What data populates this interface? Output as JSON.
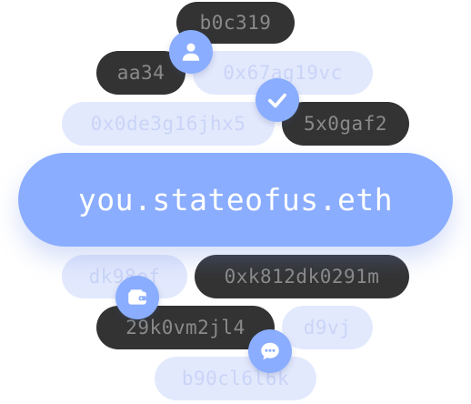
{
  "handles": {
    "h1": "b0c319",
    "h2": "aa34",
    "h3": "0x67ag19vc",
    "h4": "0x0de3g16jhx5",
    "h5": "5x0gaf2",
    "h6": "dk98ef",
    "h7": "0xk812dk0291m",
    "h8": "29k0vm2jl4",
    "h9": "d9vj",
    "h10": "b90cl6l6k"
  },
  "main_identity": "you.stateofus.eth",
  "icons": {
    "user": "user-icon",
    "check": "checkmark-icon",
    "wallet": "wallet-icon",
    "chat": "chat-bubble-icon"
  },
  "colors": {
    "accent": "#8aadff",
    "dark_pill": "#333333",
    "light_pill": "#e3e9fd"
  }
}
